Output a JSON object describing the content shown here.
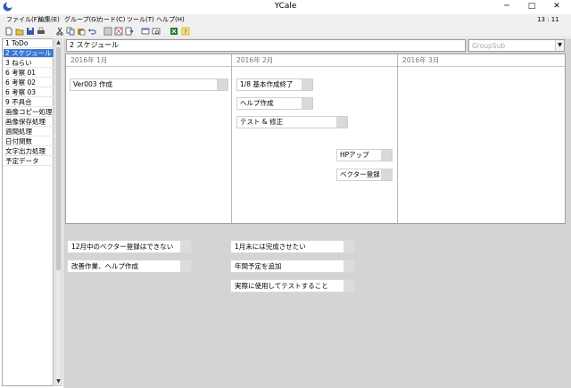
{
  "window": {
    "title": "YCale",
    "minimize": "─",
    "maximize": "□",
    "close": "✕"
  },
  "menu": [
    "ファイル(F)",
    "編集(E)",
    "グループ(G)",
    "カード(C)",
    "ツール(T)",
    "ヘルプ(H)"
  ],
  "clock": "13 : 11",
  "toolbar_icons": [
    "new-file-icon",
    "open-folder-icon",
    "save-icon",
    "print-icon",
    "cut-icon",
    "copy-icon",
    "paste-icon",
    "undo-icon",
    "list-view-icon",
    "card-view-icon",
    "export-icon",
    "window-icon",
    "search-window-icon",
    "excel-icon",
    "help-icon"
  ],
  "sidebar": {
    "items": [
      {
        "label": "1 ToDo",
        "selected": false
      },
      {
        "label": "2 スケジュール",
        "selected": true
      },
      {
        "label": "3 ねらい",
        "selected": false
      },
      {
        "label": "6 考察 01",
        "selected": false
      },
      {
        "label": "6 考察 02",
        "selected": false
      },
      {
        "label": "6 考察 03",
        "selected": false
      },
      {
        "label": "9 不具合",
        "selected": false
      },
      {
        "label": "画像コピー処理",
        "selected": false
      },
      {
        "label": "画像保存処理",
        "selected": false
      },
      {
        "label": "週間処理",
        "selected": false
      },
      {
        "label": "日付関数",
        "selected": false
      },
      {
        "label": "文字出力処理",
        "selected": false
      },
      {
        "label": "予定データ",
        "selected": false
      }
    ]
  },
  "schedule": {
    "title": "2 スケジュール",
    "group_select": "GroupSub",
    "months": [
      "2016年 1月",
      "2016年 2月",
      "2016年 3月"
    ],
    "tasks": [
      "Ver003 作成",
      "1/8 基本作成終了",
      "ヘルプ作成",
      "テスト & 修正",
      "HPアップ",
      "ベクター登録"
    ]
  },
  "notes": [
    "12月中のベクター登録はできない",
    "改善作業、ヘルプ作成",
    "1月末には完成させたい",
    "年間予定を追加",
    "実際に使用してテストすること"
  ],
  "colors": {
    "selection": "#3b78d6",
    "workspace": "#d4d4d4",
    "excel": "#1e7b34",
    "help": "#c8a800"
  }
}
